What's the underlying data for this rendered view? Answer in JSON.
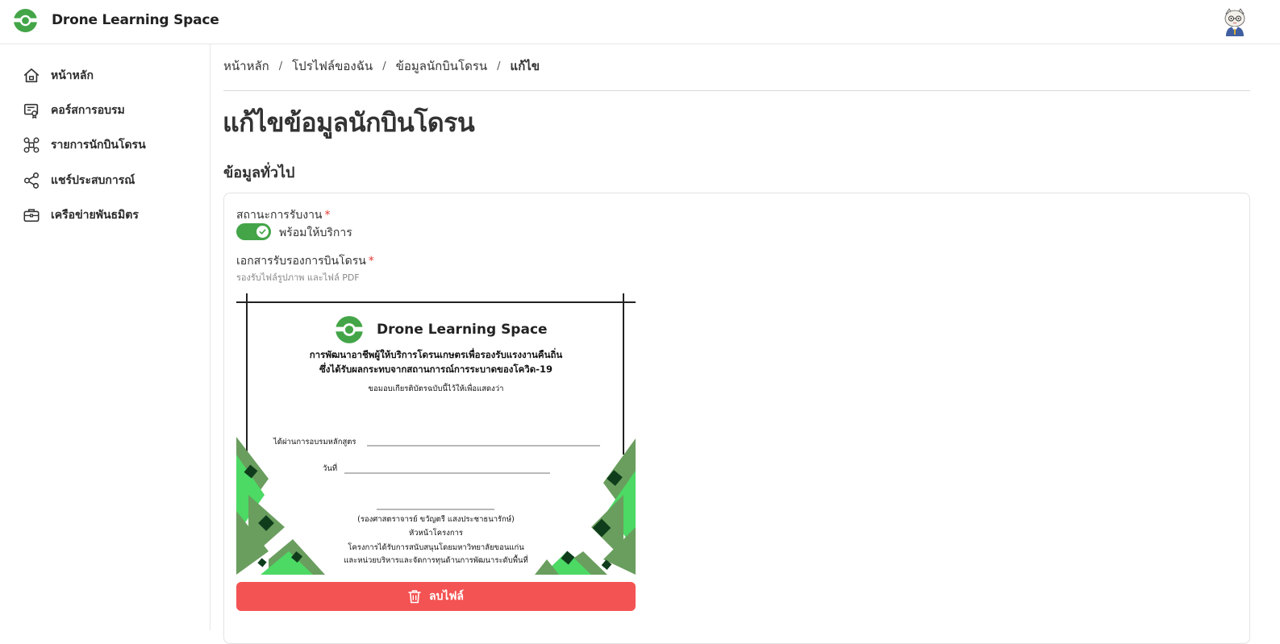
{
  "app": {
    "name": "Drone Learning Space"
  },
  "sidebar": {
    "items": [
      {
        "label": "หน้าหลัก",
        "icon": "home-icon"
      },
      {
        "label": "คอร์สการอบรม",
        "icon": "course-icon"
      },
      {
        "label": "รายการนักบินโดรน",
        "icon": "drone-icon"
      },
      {
        "label": "แชร์ประสบการณ์",
        "icon": "share-icon"
      },
      {
        "label": "เครือข่ายพันธมิตร",
        "icon": "briefcase-icon"
      }
    ]
  },
  "breadcrumb": {
    "items": [
      "หน้าหลัก",
      "โปรไฟล์ของฉัน",
      "ข้อมูลนักบินโดรน",
      "แก้ไข"
    ],
    "separator": "/"
  },
  "page": {
    "title": "แก้ไขข้อมูลนักบินโดรน",
    "section_title": "ข้อมูลทั่วไป"
  },
  "form": {
    "status_label": "สถานะการรับงาน",
    "required_mark": "*",
    "status_toggle_on": true,
    "status_value": "พร้อมให้บริการ",
    "document_label": "เอกสารรับรองการบินโดรน",
    "document_hint": "รองรับไฟล์รูปภาพ และไฟล์ PDF",
    "delete_button": "ลบไฟล์"
  },
  "certificate": {
    "brand": "Drone Learning Space",
    "title_line1": "การพัฒนาอาชีพผู้ให้บริการโดรนเกษตรเพื่อรองรับแรงงานคืนถิ่น",
    "title_line2": "ซึ่งได้รับผลกระทบจากสถานการณ์การระบาดของโควิด-19",
    "subtitle": "ขอมอบเกียรติบัตรฉบับนี้ไว้ให้เพื่อแสดงว่า",
    "course_label": "ได้ผ่านการอบรมหลักสูตร",
    "date_label": "วันที่",
    "signer_name": "(รองศาสตราจารย์ ขวัญตรี แสงประชาธนารักษ์)",
    "signer_role": "หัวหน้าโครงการ",
    "support_line1": "โครงการได้รับการสนับสนุนโดยมหาวิทยาลัยขอนแก่น",
    "support_line2": "และหน่วยบริหารและจัดการทุนด้านการพัฒนาระดับพื้นที่"
  },
  "colors": {
    "brand_green": "#43a547",
    "danger": "#f45353",
    "required": "#e53935"
  }
}
